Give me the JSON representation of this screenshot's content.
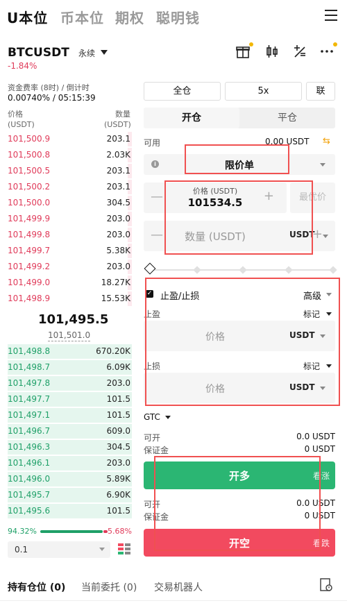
{
  "top_tabs": [
    "U本位",
    "币本位",
    "期权",
    "聪明钱"
  ],
  "symbol": "BTCUSDT",
  "contract_type": "永续",
  "price_change": "-1.84%",
  "funding": {
    "label": "资金费率 (8时) / 倒计时",
    "value": "0.00740% / 05:15:39"
  },
  "orderbook": {
    "price_header": "价格",
    "price_unit": "(USDT)",
    "qty_header": "数量",
    "qty_unit": "(USDT)",
    "asks": [
      {
        "price": "101,500.9",
        "qty": "203.1",
        "depth": 0.03
      },
      {
        "price": "101,500.8",
        "qty": "2.03K",
        "depth": 0.03
      },
      {
        "price": "101,500.5",
        "qty": "203.1",
        "depth": 0.03
      },
      {
        "price": "101,500.2",
        "qty": "203.1",
        "depth": 0.03
      },
      {
        "price": "101,500.0",
        "qty": "304.5",
        "depth": 0.03
      },
      {
        "price": "101,499.9",
        "qty": "203.0",
        "depth": 0.03
      },
      {
        "price": "101,499.8",
        "qty": "203.0",
        "depth": 0.03
      },
      {
        "price": "101,499.7",
        "qty": "5.38K",
        "depth": 0.03
      },
      {
        "price": "101,499.2",
        "qty": "203.0",
        "depth": 0.03
      },
      {
        "price": "101,499.0",
        "qty": "18.27K",
        "depth": 0.03
      },
      {
        "price": "101,498.9",
        "qty": "15.53K",
        "depth": 0.03
      }
    ],
    "last_price": "101,495.5",
    "mark_price": "101,501.0",
    "bids": [
      {
        "price": "101,498.8",
        "qty": "670.20K",
        "depth": 0.94
      },
      {
        "price": "101,498.7",
        "qty": "6.09K",
        "depth": 0.94
      },
      {
        "price": "101,497.8",
        "qty": "203.0",
        "depth": 0.94
      },
      {
        "price": "101,497.7",
        "qty": "101.5",
        "depth": 0.94
      },
      {
        "price": "101,497.1",
        "qty": "101.5",
        "depth": 0.94
      },
      {
        "price": "101,496.7",
        "qty": "609.0",
        "depth": 0.94
      },
      {
        "price": "101,496.3",
        "qty": "304.5",
        "depth": 0.94
      },
      {
        "price": "101,496.1",
        "qty": "203.0",
        "depth": 0.94
      },
      {
        "price": "101,496.0",
        "qty": "5.89K",
        "depth": 0.94
      },
      {
        "price": "101,495.7",
        "qty": "6.90K",
        "depth": 0.94
      },
      {
        "price": "101,495.6",
        "qty": "101.5",
        "depth": 0.94
      }
    ],
    "buy_ratio": "94.32%",
    "sell_ratio": "5.68%",
    "precision": "0.1"
  },
  "trade": {
    "margin_mode": "全仓",
    "leverage": "5x",
    "combine": "联",
    "tab_open": "开仓",
    "tab_close": "平仓",
    "available_label": "可用",
    "available_value": "0.00 USDT",
    "order_type": "限价单",
    "price_caption": "价格 (USDT)",
    "price_value": "101534.5",
    "best_price": "最优价",
    "qty_placeholder": "数量 (USDT)",
    "qty_unit": "USDT",
    "tpsl_label": "止盈/止损",
    "advanced_label": "高级",
    "tp_label": "止盈",
    "sl_label": "止损",
    "mark_label": "标记",
    "tp_placeholder": "价格",
    "sl_placeholder": "价格",
    "tp_unit": "USDT",
    "sl_unit": "USDT",
    "tif": "GTC",
    "openable_label": "可开",
    "openable_value": "0.0 USDT",
    "margin_label": "保证金",
    "margin_value": "0 USDT",
    "long_label": "开多",
    "long_sub": "看涨",
    "openable_value_2": "0.0 USDT",
    "margin_value_2": "0 USDT",
    "short_label": "开空",
    "short_sub": "看跌"
  },
  "bottom_tabs": [
    "持有仓位 (0)",
    "当前委托 (0)",
    "交易机器人"
  ],
  "colors": {
    "buy": "#2bb673",
    "sell": "#f24a5f",
    "highlight": "#f05050",
    "accent": "#f2b705"
  },
  "icons": [
    "menu-icon",
    "gift-icon",
    "candlestick-icon",
    "calculator-icon",
    "more-icon",
    "swap-icon",
    "info-icon",
    "orderbook-layout-icon",
    "history-icon"
  ]
}
